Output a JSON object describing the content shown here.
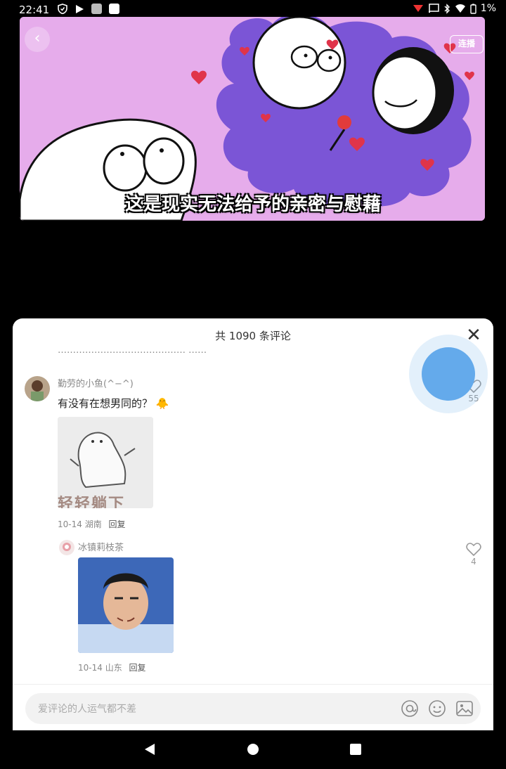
{
  "status_bar": {
    "time": "22:41",
    "battery": "1%",
    "icons": [
      "shield-icon",
      "play-icon",
      "square-icon",
      "square-icon",
      "notification-icon",
      "cast-icon",
      "bluetooth-icon",
      "wifi-icon",
      "battery-icon"
    ]
  },
  "video": {
    "subtitle": "这是现实无法给予的亲密与慰藉",
    "loop_label": "连播",
    "back_icon": "chevron-left-icon",
    "accent_color": "#e2a7e7"
  },
  "comments_panel": {
    "title": "共 1090 条评论",
    "cutoff_text": "…………………………………… ……",
    "comments": [
      {
        "author": "勤劳的小鱼(^−^)",
        "text": "有没有在想男同的？",
        "emoji": "🐥",
        "image_caption": "轻轻躺下",
        "date": "10-14",
        "location": "湖南",
        "reply_label": "回复",
        "likes": "55"
      },
      {
        "author": "冰镇莉枝茶",
        "date": "10-14",
        "location": "山东",
        "reply_label": "回复",
        "likes": "4"
      }
    ]
  },
  "input": {
    "placeholder": "爱评论的人运气都不差",
    "icons": [
      "at-icon",
      "emoji-icon",
      "image-icon"
    ]
  },
  "nav": {
    "icons": [
      "back-triangle-icon",
      "home-circle-icon",
      "recents-square-icon"
    ]
  }
}
